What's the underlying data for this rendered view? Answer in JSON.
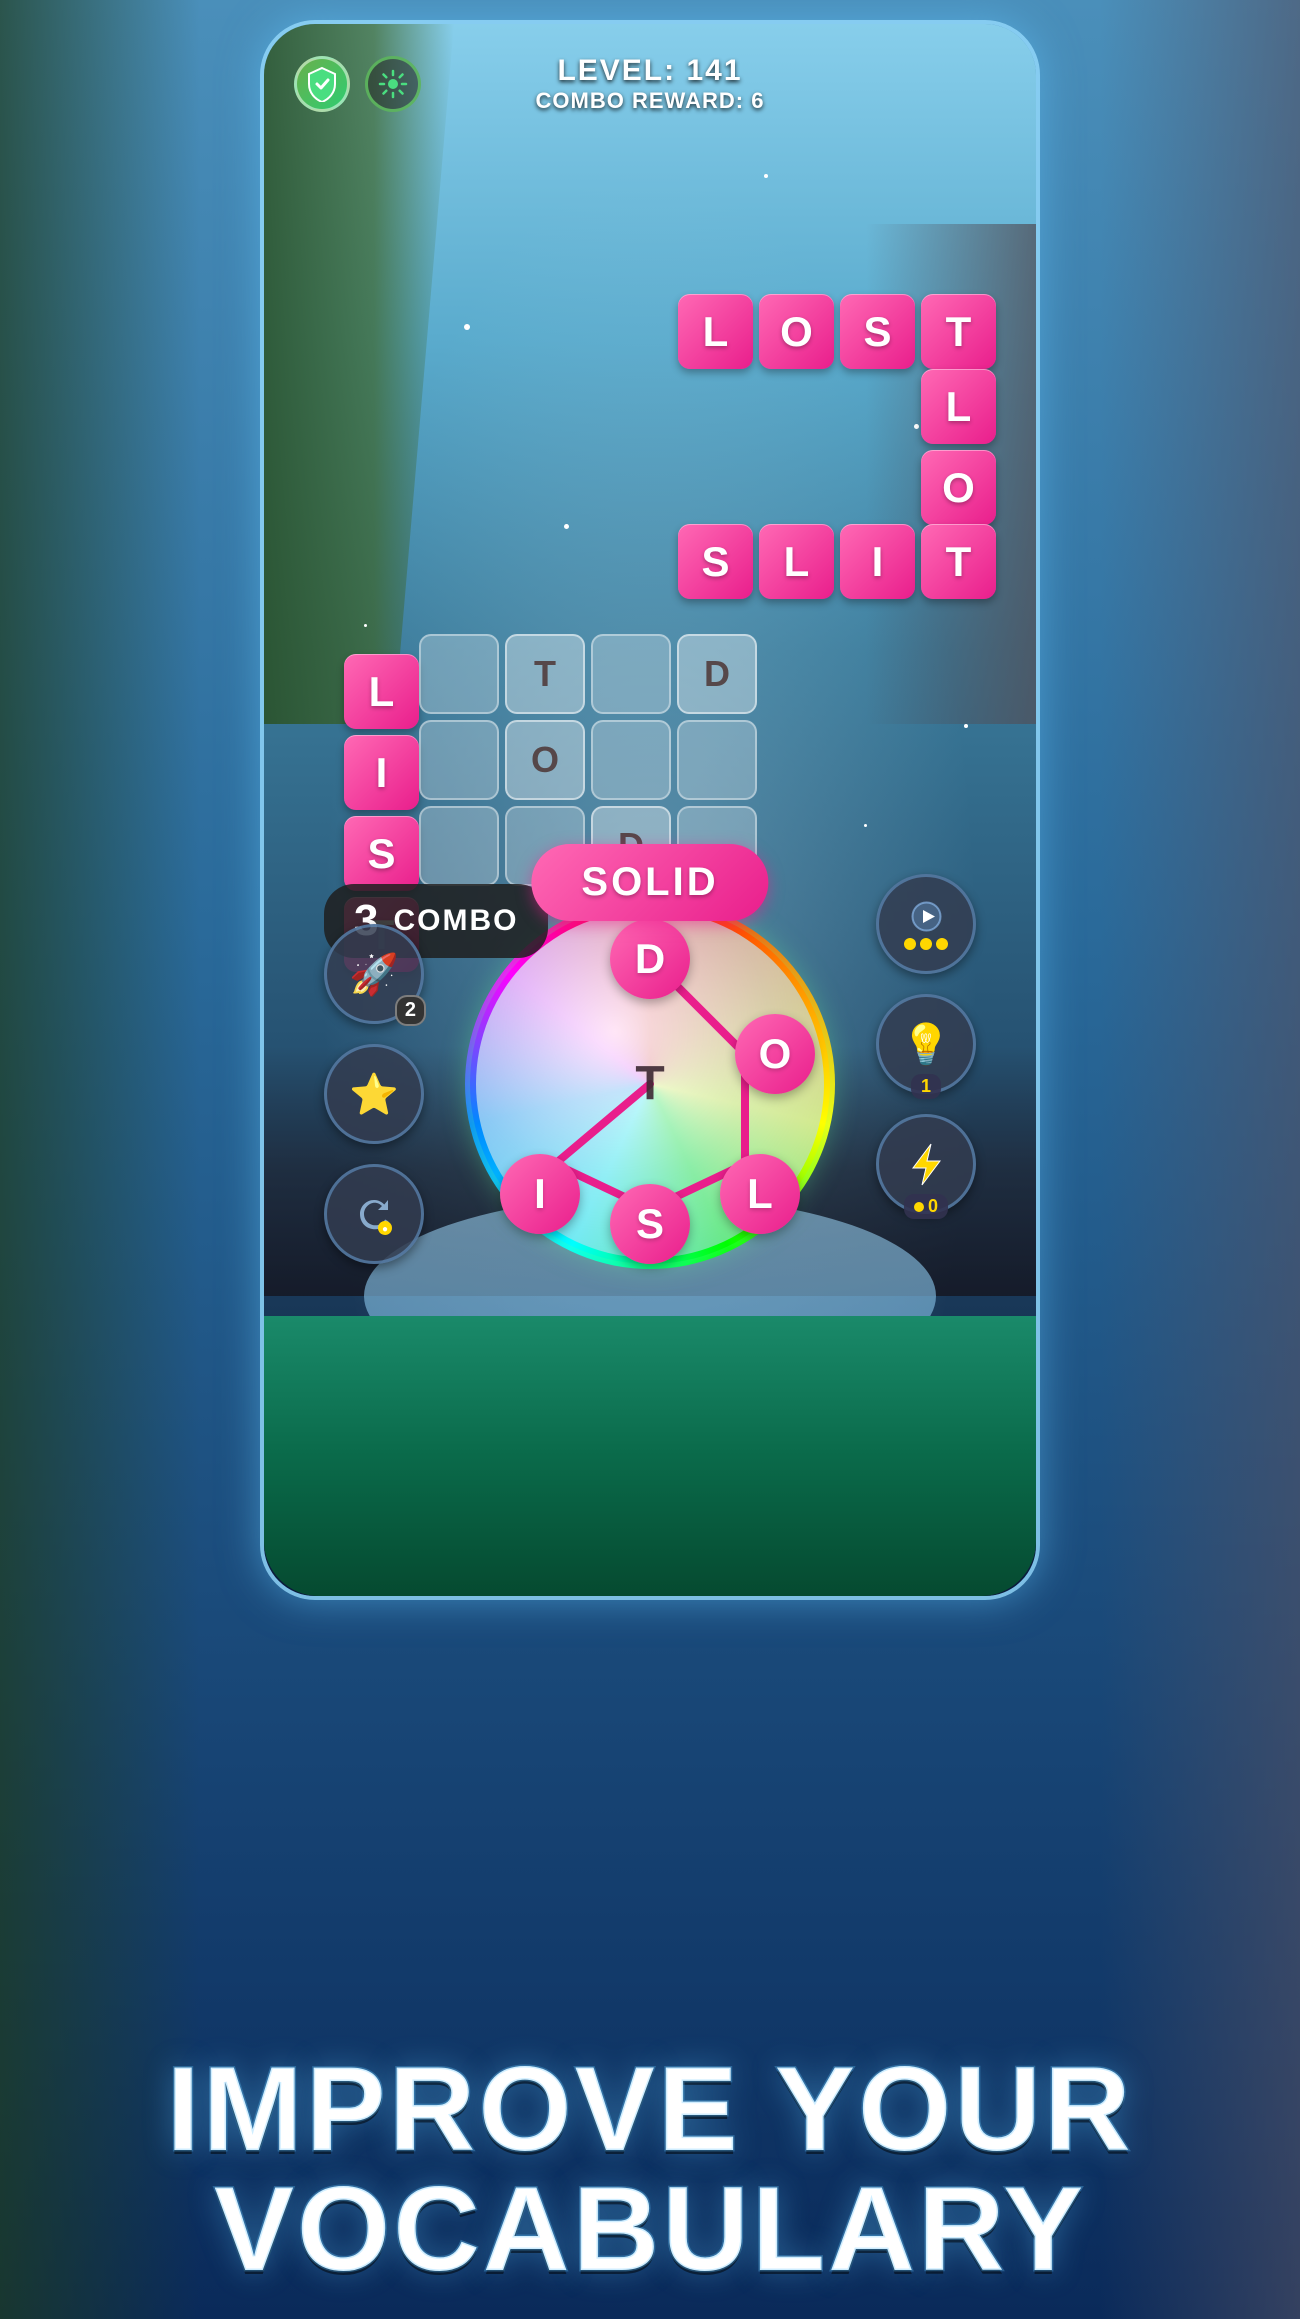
{
  "header": {
    "level_label": "LEVEL: 141",
    "combo_reward_label": "COMBO REWARD: 6"
  },
  "words": {
    "lost": [
      "L",
      "O",
      "S",
      "T"
    ],
    "vertical_t": [
      "L",
      "O"
    ],
    "slit": [
      "S",
      "L",
      "I",
      "T"
    ],
    "list": [
      "L",
      "I",
      "S",
      "T"
    ]
  },
  "grid": {
    "cells": [
      {
        "letter": "",
        "row": 0,
        "col": 0
      },
      {
        "letter": "T",
        "row": 0,
        "col": 1
      },
      {
        "letter": "",
        "row": 0,
        "col": 2
      },
      {
        "letter": "D",
        "row": 0,
        "col": 3
      },
      {
        "letter": "",
        "row": 1,
        "col": 0
      },
      {
        "letter": "O",
        "row": 1,
        "col": 1
      },
      {
        "letter": "",
        "row": 1,
        "col": 2
      },
      {
        "letter": "",
        "row": 1,
        "col": 3
      },
      {
        "letter": "",
        "row": 2,
        "col": 0
      },
      {
        "letter": "",
        "row": 2,
        "col": 1
      },
      {
        "letter": "D",
        "row": 2,
        "col": 2
      },
      {
        "letter": "",
        "row": 2,
        "col": 3
      }
    ]
  },
  "combo": {
    "number": "3",
    "label": "COMBO"
  },
  "current_word": "SOLID",
  "wheel_letters": {
    "top": "D",
    "right": "O",
    "bottom_right": "L",
    "bottom": "S",
    "bottom_left": "I",
    "center": "T"
  },
  "left_buttons": {
    "rocket_badge": "2",
    "star_label": "★",
    "refresh_label": "↻"
  },
  "right_buttons": {
    "video_label": "▶",
    "bulb_badge": "1",
    "lightning_badge": "0"
  },
  "bottom_text": {
    "line1": "IMPROVE YOUR",
    "line2": "VOCABULARY"
  },
  "colors": {
    "pink_primary": "#ff69b4",
    "pink_dark": "#e91e8c",
    "accent_green": "#2ecc71",
    "gold": "#ffd700"
  }
}
